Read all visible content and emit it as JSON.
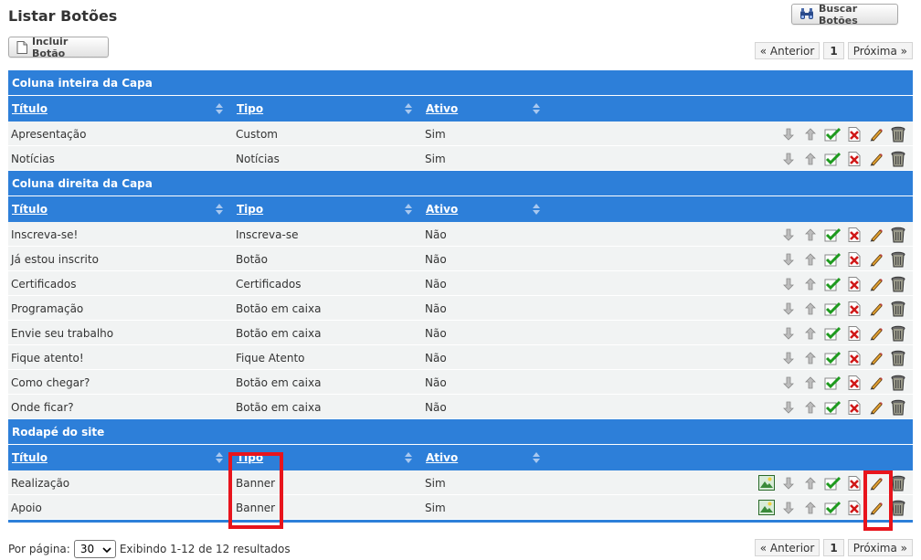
{
  "page": {
    "title": "Listar Botões",
    "search_button": "Buscar Botões",
    "add_button": "Incluir Botão"
  },
  "pager": {
    "prev": "« Anterior",
    "current": "1",
    "next": "Próxima »"
  },
  "columns": {
    "title": "Título",
    "type": "Tipo",
    "active": "Ativo"
  },
  "groups": [
    {
      "name": "Coluna inteira da Capa",
      "rows": [
        {
          "title": "Apresentação",
          "type": "Custom",
          "active": "Sim"
        },
        {
          "title": "Notícias",
          "type": "Notícias",
          "active": "Sim"
        }
      ]
    },
    {
      "name": "Coluna direita da Capa",
      "rows": [
        {
          "title": "Inscreva-se!",
          "type": "Inscreva-se",
          "active": "Não"
        },
        {
          "title": "Já estou inscrito",
          "type": "Botão",
          "active": "Não"
        },
        {
          "title": "Certificados",
          "type": "Certificados",
          "active": "Não"
        },
        {
          "title": "Programação",
          "type": "Botão em caixa",
          "active": "Não"
        },
        {
          "title": "Envie seu trabalho",
          "type": "Botão em caixa",
          "active": "Não"
        },
        {
          "title": "Fique atento!",
          "type": "Fique Atento",
          "active": "Não"
        },
        {
          "title": "Como chegar?",
          "type": "Botão em caixa",
          "active": "Não"
        },
        {
          "title": "Onde ficar?",
          "type": "Botão em caixa",
          "active": "Não"
        }
      ]
    },
    {
      "name": "Rodapé do site",
      "rows": [
        {
          "title": "Realização",
          "type": "Banner",
          "active": "Sim",
          "has_image": true
        },
        {
          "title": "Apoio",
          "type": "Banner",
          "active": "Sim",
          "has_image": true
        }
      ]
    }
  ],
  "footer": {
    "per_page_label": "Por página:",
    "per_page_value": "30",
    "results_text": "Exibindo 1-12 de 12 resultados"
  },
  "icons": {
    "move_down": "arrow-down-icon",
    "move_up": "arrow-up-icon",
    "activate": "check-icon",
    "deactivate": "delete-x-icon",
    "edit": "pencil-icon",
    "remove": "trash-icon",
    "image": "image-icon"
  },
  "colors": {
    "header_blue": "#2d7fd9",
    "row_bg": "#f1f3f3",
    "highlight_red": "#e8141c"
  }
}
